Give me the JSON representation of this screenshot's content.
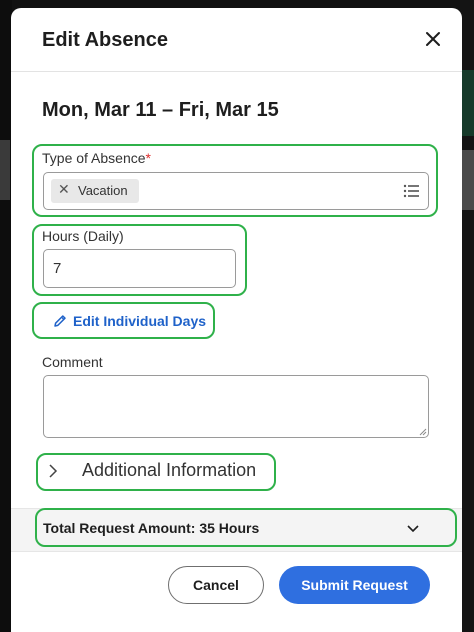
{
  "dialog": {
    "title": "Edit Absence",
    "date_range": "Mon, Mar 11 – Fri, Mar 15"
  },
  "type_of_absence": {
    "label": "Type of Absence",
    "required_mark": "*",
    "selected": [
      "Vacation"
    ]
  },
  "hours": {
    "label": "Hours (Daily)",
    "value": "7"
  },
  "edit_days": {
    "label": "Edit Individual Days"
  },
  "comment": {
    "label": "Comment",
    "value": ""
  },
  "additional_info": {
    "label": "Additional Information"
  },
  "summary": {
    "text": "Total Request Amount: 35 Hours"
  },
  "buttons": {
    "cancel": "Cancel",
    "submit": "Submit Request"
  },
  "colors": {
    "highlight": "#2fb14a",
    "primary": "#2f6fe0",
    "link": "#1f62c9",
    "required": "#de2c2c"
  },
  "icons": {
    "close": "close-icon",
    "chip_remove": "remove-chip-icon",
    "list": "list-icon",
    "pencil": "pencil-icon",
    "expand": "chevron-right-icon",
    "collapse": "chevron-down-icon"
  }
}
